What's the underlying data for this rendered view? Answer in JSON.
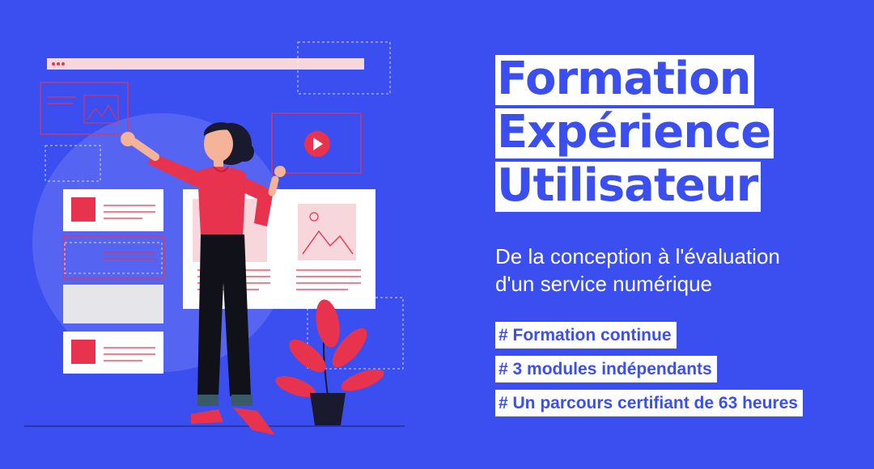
{
  "title_lines": [
    "Formation",
    "Expérience",
    "Utilisateur"
  ],
  "subtitle_lines": [
    "De la conception à l'évaluation",
    "d'un service numérique"
  ],
  "tags": [
    "# Formation continue",
    "# 3 modules indépendants",
    "# Un parcours certifiant de 63 heures"
  ],
  "colors": {
    "background": "#3b4ef0",
    "accent": "#e8334f",
    "panel": "#ffffff",
    "skin": "#f5b49a",
    "hair": "#1a1a2e"
  }
}
